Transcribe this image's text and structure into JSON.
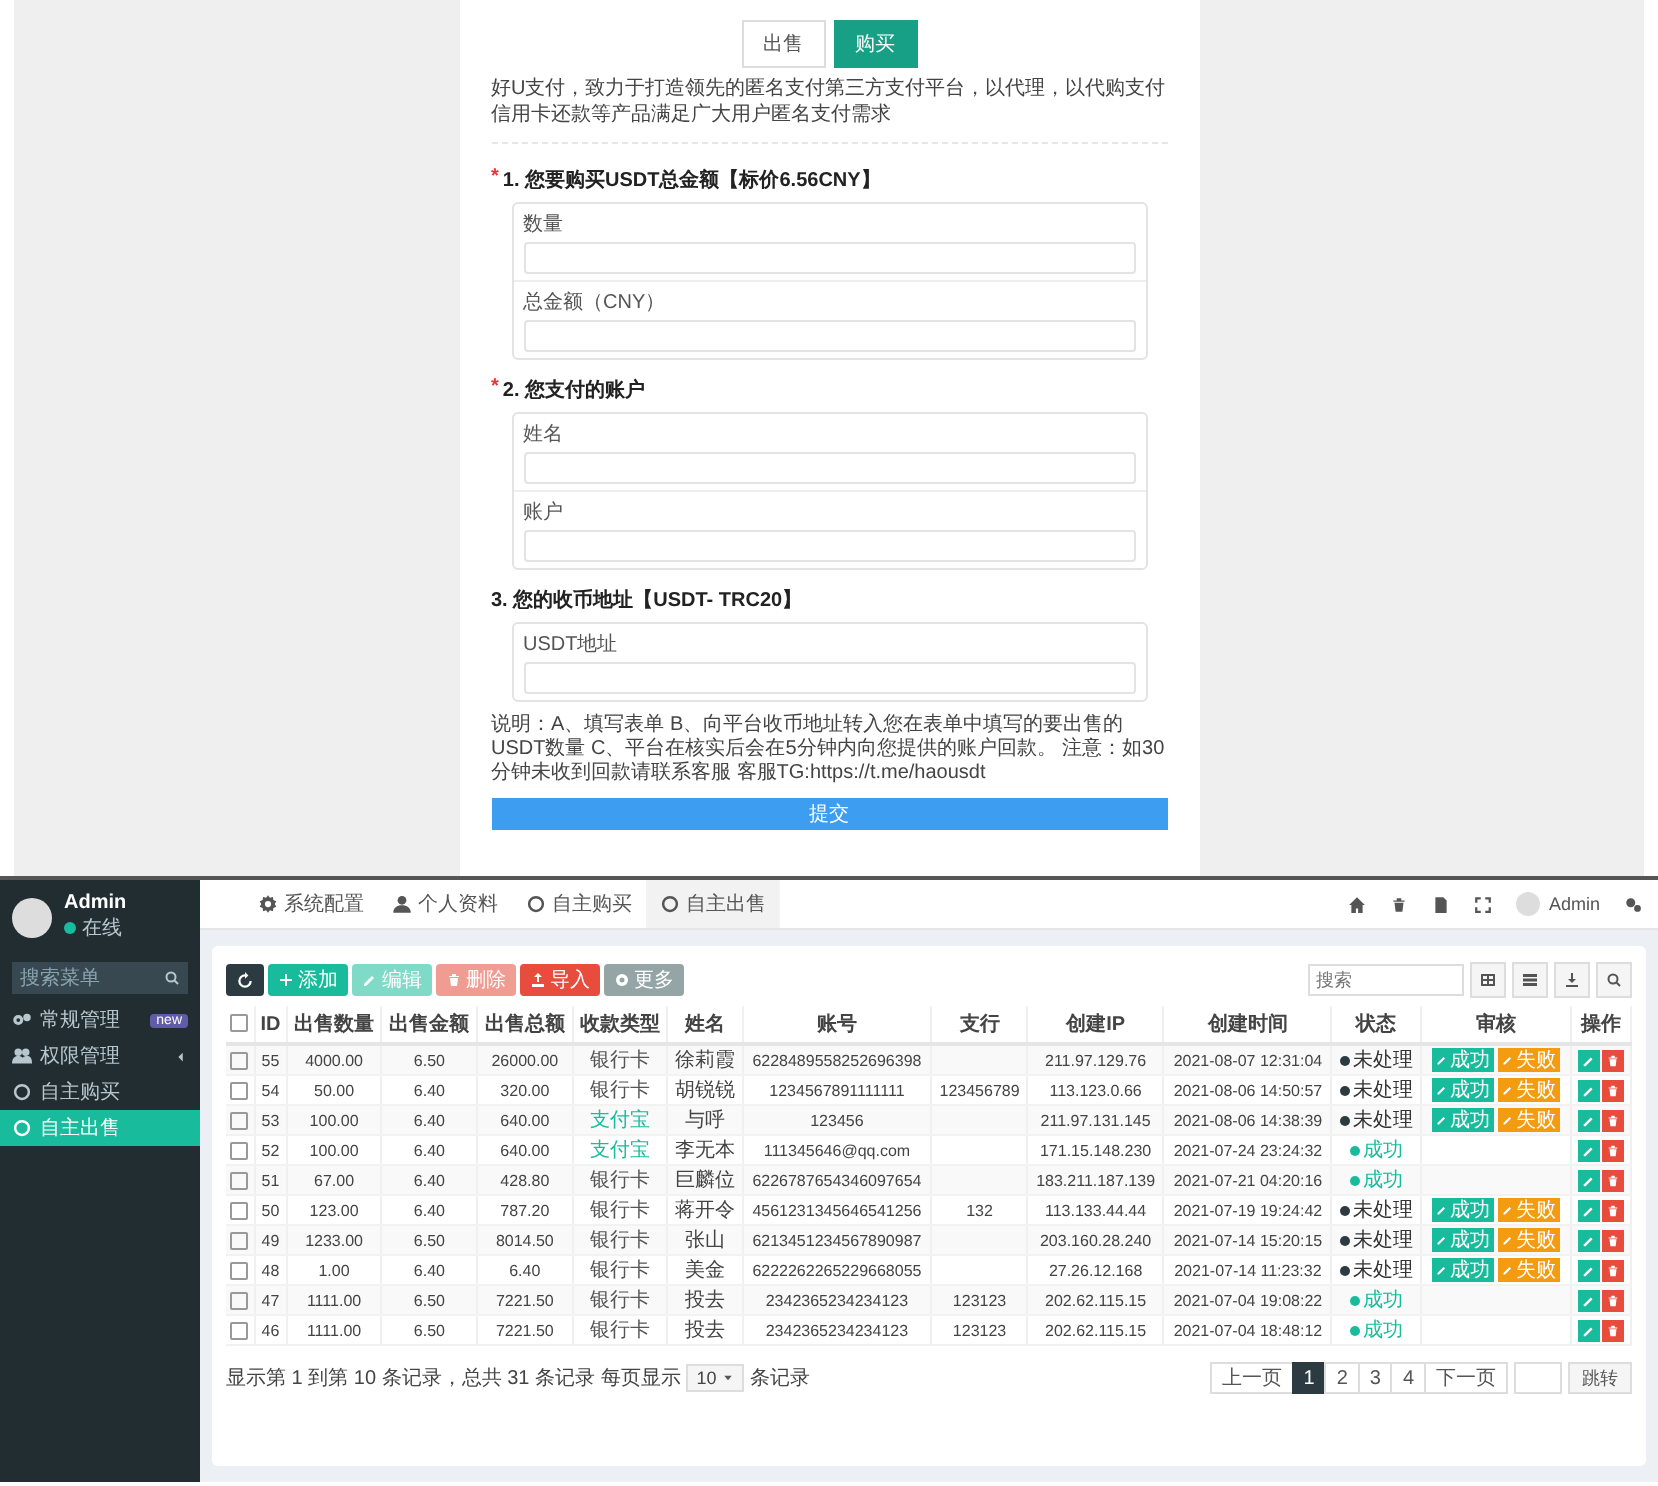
{
  "form_page": {
    "tabs": [
      {
        "label": "出售",
        "selected": false
      },
      {
        "label": "购买",
        "selected": true
      }
    ],
    "intro": "好U支付，致力于打造领先的匿名支付第三方支付平台，以代理，以代购支付信用卡还款等产品满足广大用户匿名支付需求",
    "sections": [
      {
        "title": "1. 您要购买USDT总金额【标价6.56CNY】",
        "required_mark": "*",
        "fields": [
          {
            "label": "数量"
          },
          {
            "label": "总金额（CNY）"
          }
        ]
      },
      {
        "title": "2. 您支付的账户",
        "required_mark": "*",
        "fields": [
          {
            "label": "姓名"
          },
          {
            "label": "账户"
          }
        ]
      },
      {
        "title": "3. 您的收币地址【USDT- TRC20】",
        "fields": [
          {
            "label": "USDT地址"
          }
        ]
      }
    ],
    "note": "说明：A、填写表单 B、向平台收币地址转入您在表单中填写的要出售的USDT数量 C、平台在核实后会在5分钟内向您提供的账户回款。 注意：如30分钟未收到回款请联系客服 客服TG:https://t.me/haousdt",
    "submit": "提交"
  },
  "admin": {
    "sidebar": {
      "user": "Admin",
      "status": "在线",
      "search": {
        "placeholder": "搜索菜单"
      },
      "items": [
        {
          "label": "常规管理",
          "kind": "gears",
          "badge": "new",
          "expandable": false,
          "selected": false
        },
        {
          "label": "权限管理",
          "kind": "group",
          "expandable": true,
          "selected": false
        },
        {
          "label": "自主购买",
          "kind": "circle",
          "expandable": false,
          "selected": false
        },
        {
          "label": "自主出售",
          "kind": "circle",
          "expandable": false,
          "selected": true
        }
      ]
    },
    "topbar": {
      "tabs": [
        {
          "label": "系统配置",
          "kind": "gear",
          "selected": false
        },
        {
          "label": "个人资料",
          "kind": "user",
          "selected": false
        },
        {
          "label": "自主购买",
          "kind": "circle",
          "selected": false
        },
        {
          "label": "自主出售",
          "kind": "circle",
          "selected": true
        }
      ],
      "user": "Admin"
    },
    "toolbar": [
      {
        "kind": "refresh",
        "disabled": false
      },
      {
        "kind": "add",
        "label": "添加",
        "disabled": false
      },
      {
        "kind": "edit",
        "label": "编辑",
        "disabled": true
      },
      {
        "kind": "delete",
        "label": "删除",
        "disabled": true
      },
      {
        "kind": "import",
        "label": "导入",
        "disabled": false
      },
      {
        "kind": "more",
        "label": "更多",
        "disabled": false
      }
    ],
    "search": {
      "placeholder": "搜索"
    },
    "table": {
      "header_checked": false,
      "columns": [
        "ID",
        "出售数量",
        "出售金额",
        "出售总额",
        "收款类型",
        "姓名",
        "账号",
        "支行",
        "创建IP",
        "创建时间",
        "状态",
        "审核",
        "操作"
      ],
      "rows": [
        {
          "checked": false,
          "id": "55",
          "quantity": "4000.00",
          "price": "6.50",
          "total": "26000.00",
          "pay_type": {
            "label": "银行卡",
            "kind": "bank"
          },
          "name": "徐莉霞",
          "account": "6228489558252696398",
          "ip": "211.97.129.76",
          "created": "2021-08-07 12:31:04",
          "status": {
            "label": "未处理",
            "kind": "pending"
          },
          "audit_buttons": [
            "成功",
            "失败"
          ]
        },
        {
          "checked": false,
          "id": "54",
          "quantity": "50.00",
          "price": "6.40",
          "total": "320.00",
          "pay_type": {
            "label": "银行卡",
            "kind": "bank"
          },
          "name": "胡锐锐",
          "account": "1234567891111111",
          "bank": "123456789",
          "ip": "113.123.0.66",
          "created": "2021-08-06 14:50:57",
          "status": {
            "label": "未处理",
            "kind": "pending"
          },
          "audit_buttons": [
            "成功",
            "失败"
          ]
        },
        {
          "checked": false,
          "id": "53",
          "quantity": "100.00",
          "price": "6.40",
          "total": "640.00",
          "pay_type": {
            "label": "支付宝",
            "kind": "alipay"
          },
          "name": "与呼",
          "account": "123456",
          "ip": "211.97.131.145",
          "created": "2021-08-06 14:38:39",
          "status": {
            "label": "未处理",
            "kind": "pending"
          },
          "audit_buttons": [
            "成功",
            "失败"
          ]
        },
        {
          "checked": false,
          "id": "52",
          "quantity": "100.00",
          "price": "6.40",
          "total": "640.00",
          "pay_type": {
            "label": "支付宝",
            "kind": "alipay"
          },
          "name": "李无本",
          "account": "111345646@qq.com",
          "ip": "171.15.148.230",
          "created": "2021-07-24 23:24:32",
          "status": {
            "label": "成功",
            "kind": "success"
          }
        },
        {
          "checked": false,
          "id": "51",
          "quantity": "67.00",
          "price": "6.40",
          "total": "428.80",
          "pay_type": {
            "label": "银行卡",
            "kind": "bank"
          },
          "name": "巨麟位",
          "account": "6226787654346097654",
          "ip": "183.211.187.139",
          "created": "2021-07-21 04:20:16",
          "status": {
            "label": "成功",
            "kind": "success"
          }
        },
        {
          "checked": false,
          "id": "50",
          "quantity": "123.00",
          "price": "6.40",
          "total": "787.20",
          "pay_type": {
            "label": "银行卡",
            "kind": "bank"
          },
          "name": "蒋开令",
          "account": "4561231345646541256",
          "bank": "132",
          "ip": "113.133.44.44",
          "created": "2021-07-19 19:24:42",
          "status": {
            "label": "未处理",
            "kind": "pending"
          },
          "audit_buttons": [
            "成功",
            "失败"
          ]
        },
        {
          "checked": false,
          "id": "49",
          "quantity": "1233.00",
          "price": "6.50",
          "total": "8014.50",
          "pay_type": {
            "label": "银行卡",
            "kind": "bank"
          },
          "name": "张山",
          "account": "6213451234567890987",
          "ip": "203.160.28.240",
          "created": "2021-07-14 15:20:15",
          "status": {
            "label": "未处理",
            "kind": "pending"
          },
          "audit_buttons": [
            "成功",
            "失败"
          ]
        },
        {
          "checked": false,
          "id": "48",
          "quantity": "1.00",
          "price": "6.40",
          "total": "6.40",
          "pay_type": {
            "label": "银行卡",
            "kind": "bank"
          },
          "name": "美金",
          "account": "6222262265229668055",
          "ip": "27.26.12.168",
          "created": "2021-07-14 11:23:32",
          "status": {
            "label": "未处理",
            "kind": "pending"
          },
          "audit_buttons": [
            "成功",
            "失败"
          ]
        },
        {
          "checked": false,
          "id": "47",
          "quantity": "1111.00",
          "price": "6.50",
          "total": "7221.50",
          "pay_type": {
            "label": "银行卡",
            "kind": "bank"
          },
          "name": "投去",
          "account": "2342365234234123",
          "bank": "123123",
          "ip": "202.62.115.15",
          "created": "2021-07-04 19:08:22",
          "status": {
            "label": "成功",
            "kind": "success"
          }
        },
        {
          "checked": false,
          "id": "46",
          "quantity": "1111.00",
          "price": "6.50",
          "total": "7221.50",
          "pay_type": {
            "label": "银行卡",
            "kind": "bank"
          },
          "name": "投去",
          "account": "2342365234234123",
          "bank": "123123",
          "ip": "202.62.115.15",
          "created": "2021-07-04 18:48:12",
          "status": {
            "label": "成功",
            "kind": "success"
          }
        }
      ]
    },
    "footer": {
      "summary": "显示第 1 到第 10 条记录，总共 31 条记录 每页显示",
      "page_size": "10",
      "suffix": "条记录"
    },
    "pagination": {
      "prev": "上一页",
      "pages": [
        {
          "label": "1",
          "selected": true
        },
        {
          "label": "2",
          "selected": false
        },
        {
          "label": "3",
          "selected": false
        },
        {
          "label": "4",
          "selected": false
        }
      ],
      "next": "下一页",
      "jump": "跳转"
    }
  }
}
